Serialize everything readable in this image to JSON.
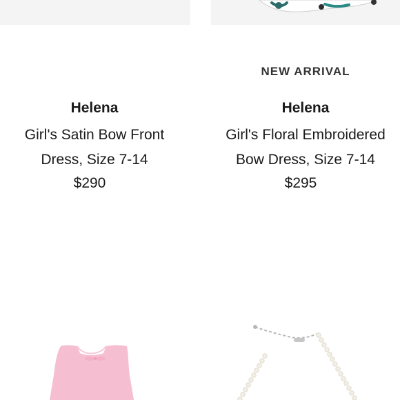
{
  "products": [
    {
      "badge": "",
      "brand": "Helena",
      "name_line1": "Girl's Satin Bow Front",
      "name_line2": "Dress, Size 7-14",
      "price": "$290"
    },
    {
      "badge": "NEW ARRIVAL",
      "brand": "Helena",
      "name_line1": "Girl's Floral Embroidered",
      "name_line2": "Bow Dress, Size 7-14",
      "price": "$295"
    }
  ],
  "colors": {
    "text": "#1a1a1a",
    "image_bg": "#f4f4f4",
    "dress_pink": "#f6bfd1",
    "pearl": "#f3efe6",
    "chain": "#b7b7b7"
  },
  "icons": {
    "top_right_image": "floral-shoe-icon",
    "bottom_left_image": "pink-dress-icon",
    "bottom_right_image": "pearl-necklace-icon"
  }
}
